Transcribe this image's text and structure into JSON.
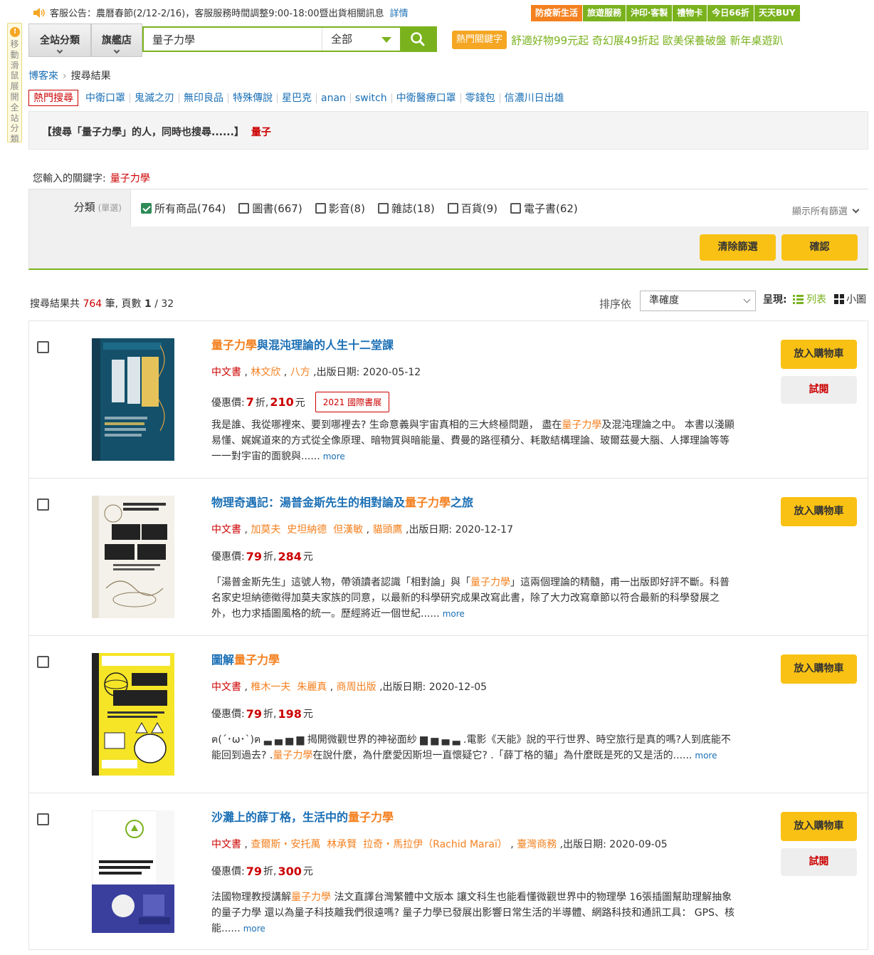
{
  "topbar": {
    "notice": "客服公告：農曆春節(2/12-2/16)，客服服務時間調整9:00-18:00暨出貨相關訊息",
    "notice_link": "詳情",
    "nav": [
      "防疫新生活",
      "旅遊服務",
      "沖印‧客製",
      "禮物卡",
      "今日66折",
      "天天BUY"
    ]
  },
  "sidetab": "移動滑鼠展開全站分類",
  "search": {
    "all_categories": "全站分類",
    "flagship": "旗艦店",
    "query": "量子力學",
    "scope": "全部",
    "hot_badge": "熱門關鍵字",
    "hot_links": "舒適好物99元起 奇幻展49折起 歐美保養破盤 新年桌遊趴"
  },
  "breadcrumb": {
    "home": "博客來",
    "current": "搜尋結果"
  },
  "hot": {
    "label": "熱門搜尋",
    "keywords": [
      "中衛口罩",
      "鬼滅之刃",
      "無印良品",
      "特殊傳說",
      "星巴克",
      "anan",
      "switch",
      "中衛醫療口罩",
      "零錢包",
      "信濃川日出雄"
    ]
  },
  "related": {
    "text": "【搜尋「量子力學」的人，同時也搜尋......】",
    "keyword": "量子"
  },
  "keyword_line": {
    "label": "您輸入的關鍵字:",
    "value": "量子力學"
  },
  "filter": {
    "label": "分類",
    "mode": "(單選)",
    "options": [
      {
        "label": "所有商品(764)",
        "checked": true
      },
      {
        "label": "圖書(667)",
        "checked": false
      },
      {
        "label": "影音(8)",
        "checked": false
      },
      {
        "label": "雜誌(18)",
        "checked": false
      },
      {
        "label": "百貨(9)",
        "checked": false
      },
      {
        "label": "電子書(62)",
        "checked": false
      }
    ],
    "show_all": "顯示所有篩選",
    "clear": "清除篩選",
    "confirm": "確認"
  },
  "results_bar": {
    "prefix": "搜尋結果共",
    "count": "764",
    "unit": "筆, 頁數",
    "page": "1",
    "pages": "/ 32",
    "sort_label": "排序依",
    "sort_value": "準確度",
    "view_label": "呈現:",
    "view_list": "列表",
    "view_thumb": "小圖"
  },
  "colors": {
    "brand_green": "#7ab21e",
    "orange": "#f4801f",
    "red": "#cc0000",
    "yellow": "#f9c114",
    "link_blue": "#1a6fb5"
  },
  "items": [
    {
      "title_hl": "量子力學",
      "title_rest": "與混沌理論的人生十二堂課",
      "title_pre": "",
      "lang": "中文書",
      "authors": "林文欣",
      "publisher": "八方",
      "date_label": "出版日期:",
      "date": "2020-05-12",
      "price_label": "優惠價:",
      "discount": "7",
      "zhe": "折,",
      "price": "210",
      "yuan": "元",
      "badge": "2021 國際書展",
      "desc_1": "我是誰、我從哪裡來、要到哪裡去? 生命意義與宇宙真相的三大終極問題， 盡在",
      "desc_hl": "量子力學",
      "desc_2": "及混沌理論之中。 本書以淺顯易懂、娓娓道來的方式從全像原理、暗物質與暗能量、費曼的路徑積分、耗散結構理論、玻爾茲曼大腦、人擇理論等等一一對宇宙的面貌與......",
      "more": "more",
      "cart": "放入購物車",
      "trial": "試閱"
    },
    {
      "title_pre": "物理奇遇記：湯普金斯先生的相對論及",
      "title_hl": "量子力學",
      "title_rest": "之旅",
      "lang": "中文書",
      "authors": "加莫夫  史坦納德  但漢敏",
      "publisher": "貓頭鷹",
      "date_label": "出版日期:",
      "date": "2020-12-17",
      "price_label": "優惠價:",
      "discount": "79",
      "zhe": "折,",
      "price": "284",
      "yuan": "元",
      "badge": "",
      "desc_1": "「湯普金斯先生」這號人物，帶領讀者認識「相對論」與「",
      "desc_hl": "量子力學",
      "desc_2": "」這兩個理論的精髓，甫一出版即好評不斷。科普名家史坦納德徵得加莫夫家族的同意，以最新的科學研究成果改寫此書，除了大力改寫章節以符合最新的科學發展之外，也力求插圖風格的統一。歷經將近一個世紀......",
      "more": "more",
      "cart": "放入購物車",
      "trial": ""
    },
    {
      "title_pre": "圖解",
      "title_hl": "量子力學",
      "title_rest": "",
      "lang": "中文書",
      "authors": "椎木一夫  朱麗真",
      "publisher": "商周出版",
      "date_label": "出版日期:",
      "date": "2020-12-05",
      "price_label": "優惠價:",
      "discount": "79",
      "zhe": "折,",
      "price": "198",
      "yuan": "元",
      "badge": "",
      "desc_1": "ฅ(´･ω･`)ฅ ▃ ▄ ▅ ▆ 揭開微觀世界的神祕面紗 ▆ ▅ ▄ ▃ .電影《天能》說的平行世界、時空旅行是真的嗎?人到底能不能回到過去? .",
      "desc_hl": "量子力學",
      "desc_2": "在說什麼，為什麼愛因斯坦一直懷疑它? .「薛丁格的貓」為什麼既是死的又是活的......",
      "more": "more",
      "cart": "放入購物車",
      "trial": ""
    },
    {
      "title_pre": "沙灘上的薛丁格，生活中的",
      "title_hl": "量子力學",
      "title_rest": "",
      "lang": "中文書",
      "authors": "查爾斯・安托萬  林承賢  拉奇・馬拉伊（Rachid Maraï）",
      "publisher": "臺灣商務",
      "date_label": "出版日期:",
      "date": "2020-09-05",
      "price_label": "優惠價:",
      "discount": "79",
      "zhe": "折,",
      "price": "300",
      "yuan": "元",
      "badge": "",
      "desc_1": "法國物理教授講解",
      "desc_hl": "量子力學",
      "desc_2": " 法文直譯台灣繁體中文版本 讓文科生也能看懂微觀世界中的物理學 16張插圖幫助理解抽象的量子力學 還以為量子科技離我們很遠嗎? 量子力學已發展出影響日常生活的半導體、網路科技和通訊工具： GPS、核能......",
      "more": "more",
      "cart": "放入購物車",
      "trial": "試閱"
    }
  ]
}
